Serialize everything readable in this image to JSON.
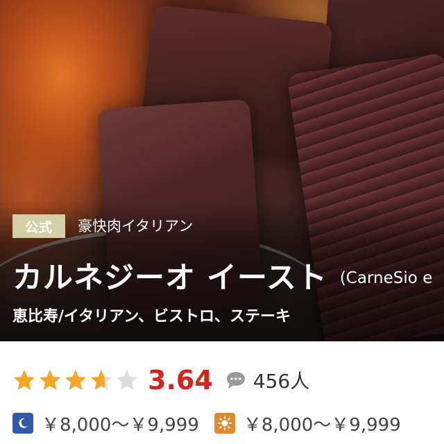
{
  "hero": {
    "badge": "公式",
    "genre_tag": "豪快肉イタリアン",
    "name": "カルネジーオ イースト",
    "name_en": "(CarneSio e",
    "location_genre": "恵比寿/イタリアン、ビストロ、ステーキ"
  },
  "rating": {
    "score": "3.64",
    "score_value": 3.64,
    "stars_max": 5,
    "star_color": "#f5a623",
    "star_empty_color": "#dddddd",
    "score_color": "#d7231b",
    "review_icon": "speech-bubble-icon",
    "review_count": "456人"
  },
  "price": {
    "dinner_icon": "moon-icon",
    "dinner": "￥8,000～￥9,999",
    "lunch_icon": "sun-icon",
    "lunch": "￥8,000～￥9,999"
  }
}
